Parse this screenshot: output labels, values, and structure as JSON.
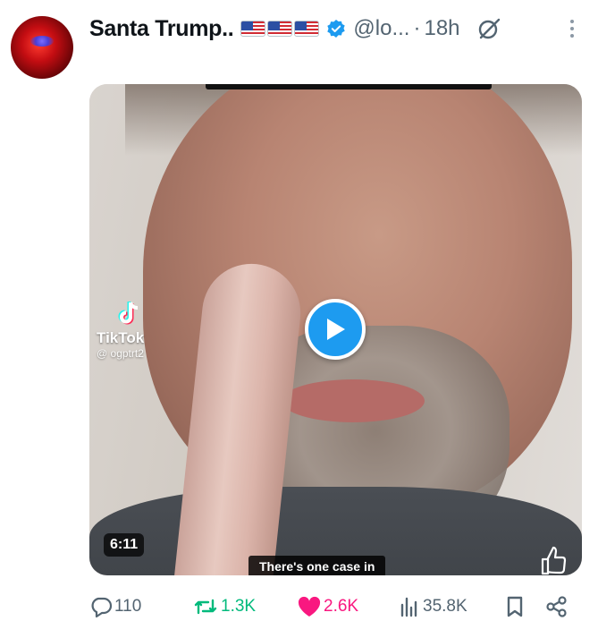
{
  "post": {
    "author": {
      "display_name": "Santa Trump..",
      "flags": "🇺🇸🇺🇸🇺🇸",
      "handle": "@lo...",
      "separator": "·",
      "time": "18h",
      "verified": true
    },
    "media": {
      "watermark_name": "TikTok",
      "watermark_user": "@ ogptrt2",
      "duration": "6:11",
      "caption": "There's one case in"
    },
    "actions": {
      "replies": "110",
      "reposts": "1.3K",
      "likes": "2.6K",
      "views": "35.8K"
    }
  },
  "colors": {
    "accent_blue": "#1d9bf0",
    "repost_green": "#00ba7c",
    "like_pink": "#f91880",
    "muted_text": "#536471"
  }
}
